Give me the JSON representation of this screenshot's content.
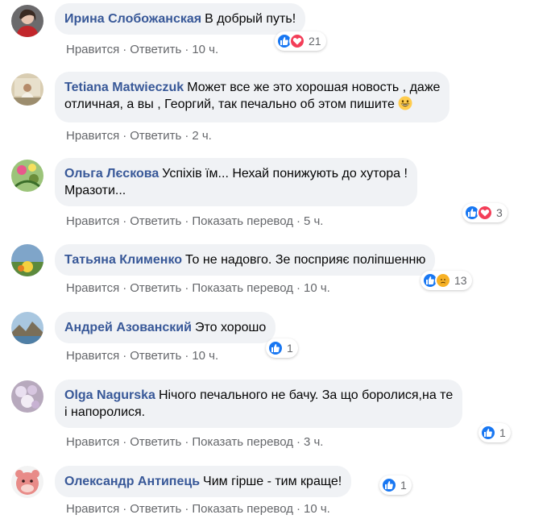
{
  "colors": {
    "like": "#1877f2",
    "love": "#f33e58",
    "sad": "#f7b125",
    "link": "#385898",
    "meta": "#65676b",
    "bubble": "#f0f2f5"
  },
  "actions": {
    "like": "Нравится",
    "reply": "Ответить",
    "translate": "Показать перевод"
  },
  "comments": [
    {
      "author": "Ирина Слобожанская",
      "text": "В добрый путь!",
      "time": "10 ч.",
      "reactions": [
        "like",
        "love"
      ],
      "count": "21"
    },
    {
      "author": "Tetiana Matwieczuk",
      "text_line1": "Может все же это хорошая новость , даже",
      "text_line2": "отличная, а вы , Георгий, так печально об этом пишите",
      "emoji": "grinning-face-emoji",
      "time": "2 ч."
    },
    {
      "author": "Ольга Лєскова",
      "text_line1": "Успіхів їм... Нехай понижують до хутора !",
      "text_line2": "Мразоти...",
      "time": "5 ч.",
      "reactions": [
        "like",
        "love"
      ],
      "count": "3"
    },
    {
      "author": "Татьяна Клименко",
      "text": "То не надовго. Зе посприяє поліпшенню",
      "time": "10 ч.",
      "reactions": [
        "like",
        "sad"
      ],
      "count": "13"
    },
    {
      "author": "Андрей Азованский",
      "text": "Это хорошо",
      "time": "10 ч.",
      "reactions": [
        "like"
      ],
      "count": "1"
    },
    {
      "author": "Olga Nagurska",
      "text_line1": "Нічого печального не бачу. За що боролися,на те",
      "text_line2": "і напоролися.",
      "time": "3 ч.",
      "reactions": [
        "like"
      ],
      "count": "1"
    },
    {
      "author": "Олександр Антипець",
      "text": "Чим гірше - тим краще!",
      "time": "10 ч.",
      "reactions": [
        "like"
      ],
      "count": "1"
    }
  ]
}
